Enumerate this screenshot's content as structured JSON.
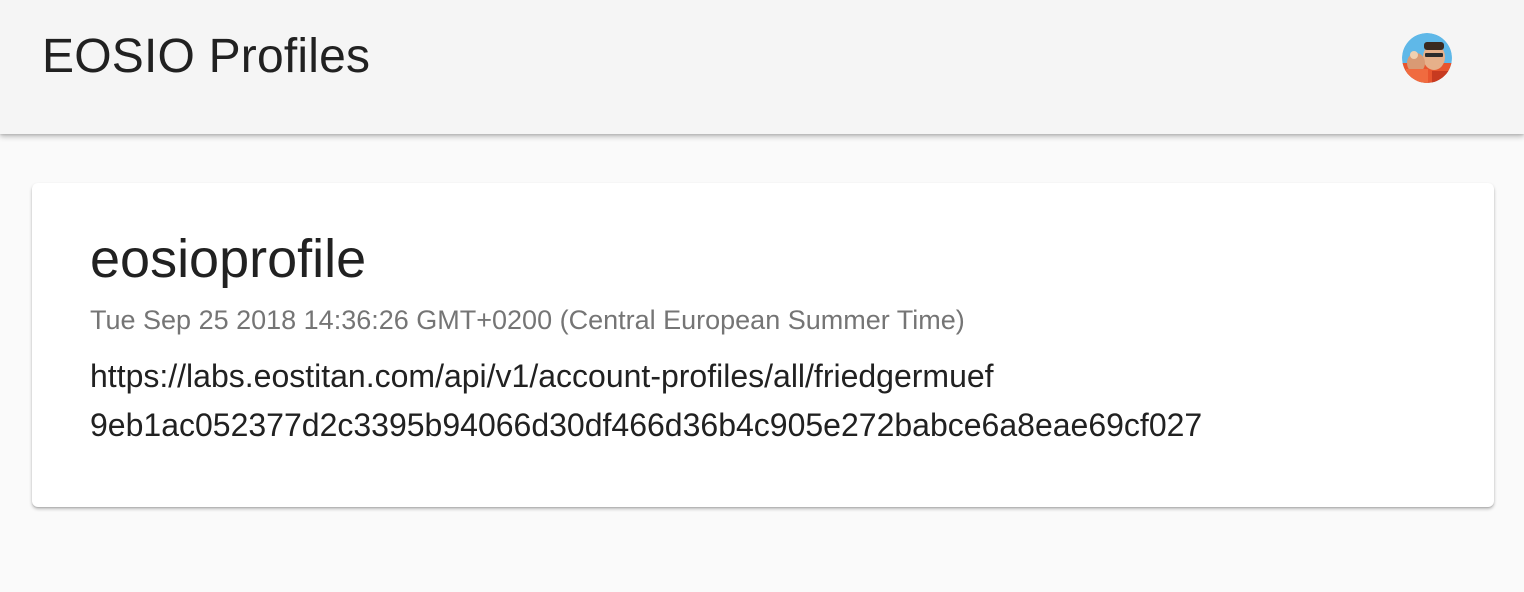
{
  "app_bar": {
    "title": "EOSIO Profiles",
    "avatar_icon": "user-avatar-photo"
  },
  "profile_card": {
    "name": "eosioprofile",
    "date": "Tue Sep 25 2018 14:36:26 GMT+0200 (Central European Summer Time)",
    "url": "https://labs.eostitan.com/api/v1/account-profiles/all/friedgermuef",
    "hash": "9eb1ac052377d2c3395b94066d30df466d36b4c905e272babce6a8eae69cf027"
  },
  "colors": {
    "app_bar_bg": "#f5f5f5",
    "page_bg": "#fafafa",
    "card_bg": "#ffffff",
    "secondary_text": "#757575",
    "primary_text": "#212121"
  }
}
